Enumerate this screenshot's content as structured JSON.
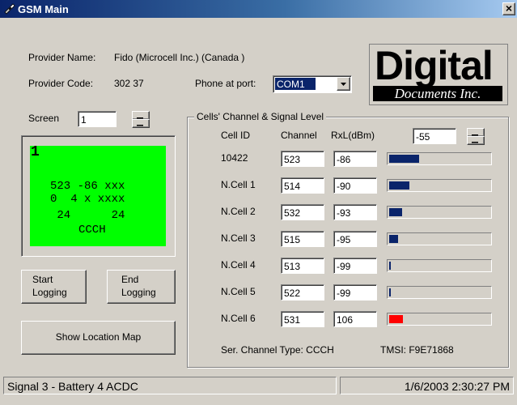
{
  "window": {
    "title": "GSM Main",
    "close_glyph": "×"
  },
  "provider": {
    "name_label": "Provider Name:",
    "name_value": "Fido (Microcell Inc.) (Canada )",
    "code_label": "Provider Code:",
    "code_value": "302 37"
  },
  "port": {
    "label": "Phone at port:",
    "value": "COM1"
  },
  "logo": {
    "line1": "Digital",
    "line2": "Documents Inc."
  },
  "screen": {
    "label": "Screen",
    "value": "1"
  },
  "lcd": {
    "line1": "1",
    "line2": "523 -86 xxx",
    "line3": "0  4 x xxxx",
    "line4": " 24      24",
    "line5": "CCCH"
  },
  "buttons": {
    "start_logging_l1": "Start",
    "start_logging_l2": "Logging",
    "end_logging_l1": "End",
    "end_logging_l2": "Logging",
    "show_location_map": "Show Location Map"
  },
  "cells_group": {
    "title": "Cells' Channel & Signal Level",
    "col_cell_id": "Cell ID",
    "col_channel": "Channel",
    "col_rxl": "RxL(dBm)",
    "threshold": "-55",
    "rows": [
      {
        "cell_id": "10422",
        "channel": "523",
        "rxl": "-86",
        "level": 0.3,
        "color": "#0a246a"
      },
      {
        "cell_id": "N.Cell 1",
        "channel": "514",
        "rxl": "-90",
        "level": 0.2,
        "color": "#0a246a"
      },
      {
        "cell_id": "N.Cell 2",
        "channel": "532",
        "rxl": "-93",
        "level": 0.13,
        "color": "#0a246a"
      },
      {
        "cell_id": "N.Cell 3",
        "channel": "515",
        "rxl": "-95",
        "level": 0.09,
        "color": "#0a246a"
      },
      {
        "cell_id": "N.Cell 4",
        "channel": "513",
        "rxl": "-99",
        "level": 0.015,
        "color": "#0a246a"
      },
      {
        "cell_id": "N.Cell 5",
        "channel": "522",
        "rxl": "-99",
        "level": 0.015,
        "color": "#0a246a"
      },
      {
        "cell_id": "N.Cell 6",
        "channel": "531",
        "rxl": "106",
        "level": 0.14,
        "color": "#ff0000"
      }
    ],
    "ser_channel_type": "Ser. Channel Type:  CCCH",
    "tmsi": "TMSI: F9E71868"
  },
  "status": {
    "left": "Signal 3 - Battery 4 ACDC",
    "right": "1/6/2003 2:30:27 PM"
  }
}
